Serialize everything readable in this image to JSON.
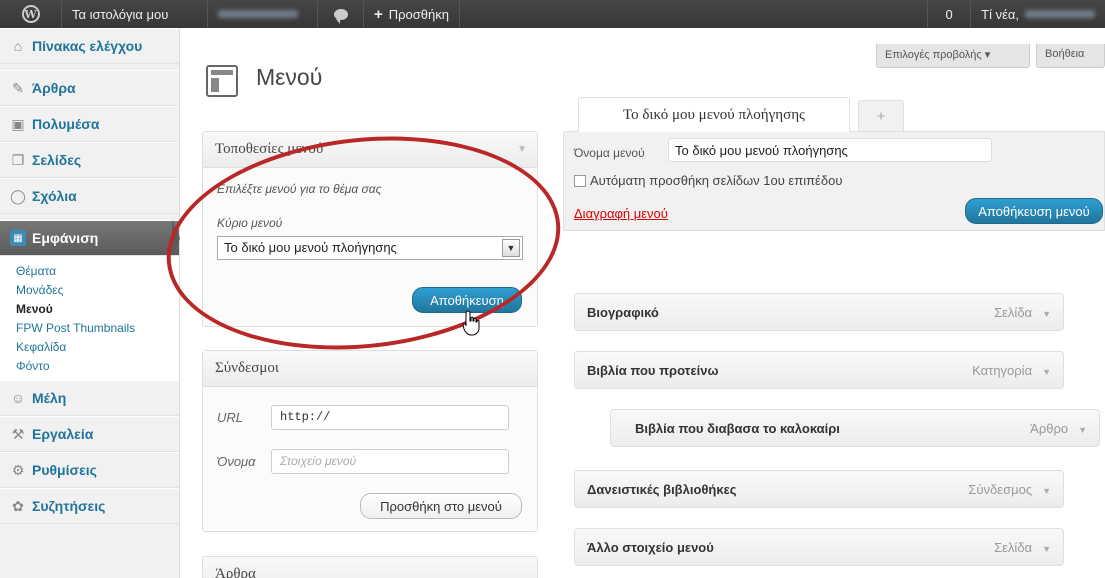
{
  "adminbar": {
    "my_sites": "Τα ιστολόγια μου",
    "new_label": "Προσθήκη",
    "count": "0",
    "howdy": "Τί νέα,"
  },
  "sidebar": {
    "dashboard": "Πίνακας ελέγχου",
    "posts": "Άρθρα",
    "media": "Πολυμέσα",
    "pages": "Σελίδες",
    "comments": "Σχόλια",
    "appearance": "Εμφάνιση",
    "submenu": [
      "Θέματα",
      "Μονάδες",
      "Μενού",
      "FPW Post Thumbnails",
      "Κεφαλίδα",
      "Φόντο"
    ],
    "users": "Μέλη",
    "tools": "Εργαλεία",
    "settings": "Ρυθμίσεις",
    "discussions": "Συζητήσεις"
  },
  "page": {
    "title": "Μενού",
    "screen_options": "Επιλογές προβολής",
    "help": "Βοήθεια"
  },
  "locations": {
    "title": "Τοποθεσίες μενού",
    "description": "Επιλέξτε μενού για το θέμα σας",
    "primary_label": "Κύριο μενού",
    "selected": "Το δικό μου μενού πλοήγησης",
    "save": "Αποθήκευση"
  },
  "links": {
    "title": "Σύνδεσμοι",
    "url_label": "URL",
    "url_value": "http://",
    "name_label": "Όνομα",
    "name_placeholder": "Στοιχείο μενού",
    "add_button": "Προσθήκη στο μενού"
  },
  "posts_box": {
    "title": "Άρθρα"
  },
  "tabs": {
    "active": "Το δικό μου μενού πλοήγησης",
    "add": "+"
  },
  "menu_header": {
    "name_label": "Όνομα μενού",
    "name_value": "Το δικό μου μενού πλοήγησης",
    "auto_add": "Αυτόματη προσθήκη σελίδων 1ου επιπέδου",
    "delete": "Διαγραφή μενού",
    "save": "Αποθήκευση μενού"
  },
  "menu_items": [
    {
      "title": "Βιογραφικό",
      "type": "Σελίδα"
    },
    {
      "title": "Βιβλία που προτείνω",
      "type": "Κατηγορία"
    },
    {
      "title": "Βιβλία που διαβασα το καλοκαίρι",
      "type": "Άρθρο"
    },
    {
      "title": "Δανειστικές βιβλιοθήκες",
      "type": "Σύνδεσμος"
    },
    {
      "title": "Άλλο στοιχείο μενού",
      "type": "Σελίδα"
    }
  ],
  "colors": {
    "accent": "#21759b",
    "highlight": "#b92727",
    "adminbar": "#464646"
  }
}
